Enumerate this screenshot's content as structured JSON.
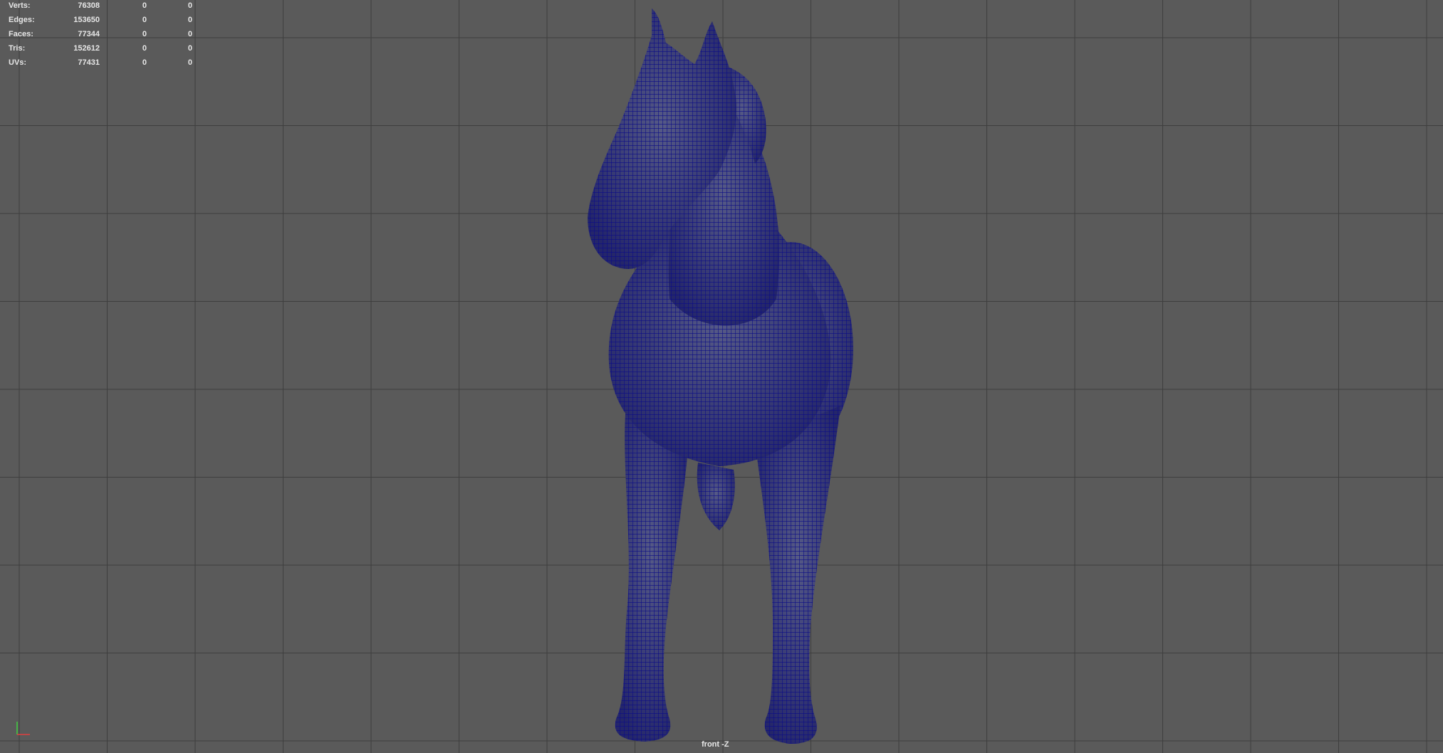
{
  "viewport": {
    "camera_label": "front -Z",
    "background_color": "#5a5a5a",
    "grid_color": "#3e3e3e",
    "wireframe_color": "#0b0c86",
    "shaded_color": "#3d4070"
  },
  "heads_up_display": {
    "rows": [
      {
        "label": "Verts:",
        "total": "76308",
        "selected": "0",
        "components": "0"
      },
      {
        "label": "Edges:",
        "total": "153650",
        "selected": "0",
        "components": "0"
      },
      {
        "label": "Faces:",
        "total": "77344",
        "selected": "0",
        "components": "0"
      },
      {
        "label": "Tris:",
        "total": "152612",
        "selected": "0",
        "components": "0"
      },
      {
        "label": "UVs:",
        "total": "77431",
        "selected": "0",
        "components": "0"
      }
    ]
  },
  "axis_gizmo": {
    "x_color": "#e04040",
    "y_color": "#40d040"
  },
  "model": {
    "name_icon": "horse-mesh-wireframe"
  }
}
